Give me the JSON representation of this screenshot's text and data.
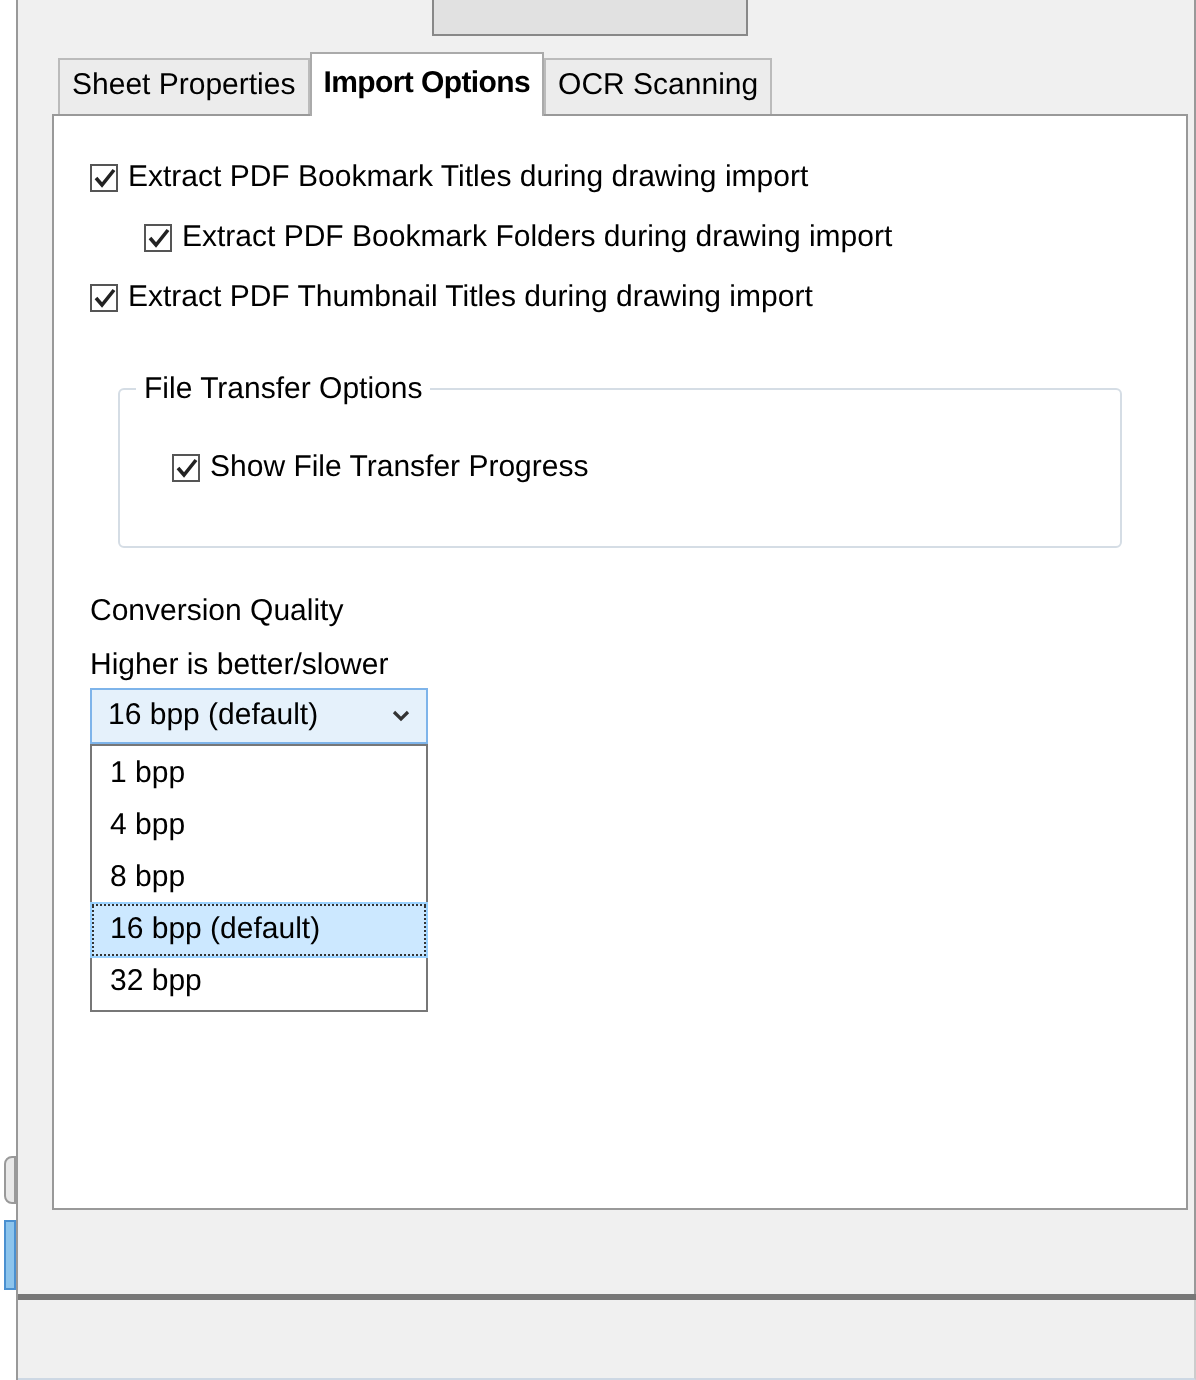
{
  "tabs": [
    {
      "label": "Sheet Properties",
      "selected": false
    },
    {
      "label": "Import Options",
      "selected": true
    },
    {
      "label": "OCR Scanning",
      "selected": false
    }
  ],
  "options": [
    {
      "label": "Extract PDF Bookmark Titles during drawing import",
      "checked": true,
      "children": [
        {
          "label": "Extract PDF Bookmark Folders during drawing import",
          "checked": true
        }
      ]
    },
    {
      "label": "Extract PDF Thumbnail Titles during drawing import",
      "checked": true
    }
  ],
  "file_transfer_group": {
    "title": "File Transfer Options",
    "options": [
      {
        "label": "Show File Transfer Progress",
        "checked": true
      }
    ]
  },
  "conversion_quality": {
    "label": "Conversion Quality",
    "hint": "Higher is better/slower",
    "value": "16 bpp (default)",
    "expanded": true,
    "options": [
      {
        "label": "1 bpp",
        "selected": false
      },
      {
        "label": "4 bpp",
        "selected": false
      },
      {
        "label": "8 bpp",
        "selected": false
      },
      {
        "label": "16 bpp (default)",
        "selected": true
      },
      {
        "label": "32 bpp",
        "selected": false
      }
    ]
  }
}
